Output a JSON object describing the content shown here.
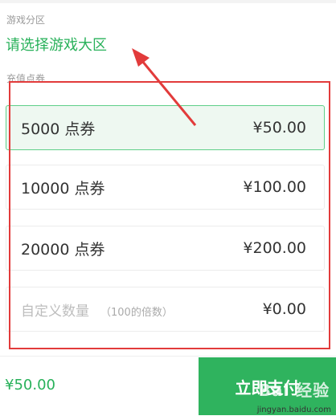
{
  "zone": {
    "label": "游戏分区",
    "value": "请选择游戏大区"
  },
  "recharge": {
    "label": "充值点券"
  },
  "options": [
    {
      "amount": "5000 点券",
      "price": "¥50.00",
      "selected": true
    },
    {
      "amount": "10000 点券",
      "price": "¥100.00",
      "selected": false
    },
    {
      "amount": "20000 点券",
      "price": "¥200.00",
      "selected": false
    }
  ],
  "custom": {
    "placeholder": "自定义数量",
    "hint": "（100的倍数）",
    "price": "¥0.00"
  },
  "footer": {
    "total": "¥50.00",
    "pay_label": "立即支付"
  },
  "watermark": {
    "main": "Bai 经验",
    "sub": "jingyan.baidu.com"
  },
  "colors": {
    "accent": "#28b15a",
    "button": "#2fb35e",
    "annotation": "#e23b3b"
  }
}
